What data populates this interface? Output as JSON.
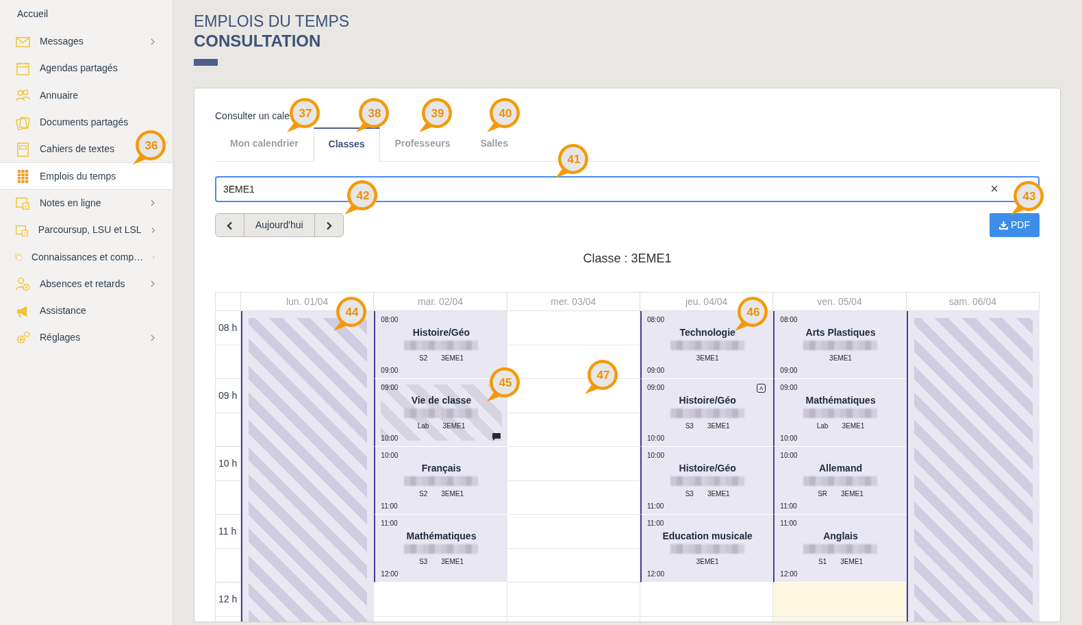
{
  "sidebar": {
    "home": "Accueil",
    "items": [
      {
        "label": "Messages",
        "submenu": true,
        "selected": false
      },
      {
        "label": "Agendas partagés",
        "submenu": false,
        "selected": false
      },
      {
        "label": "Annuaire",
        "submenu": false,
        "selected": false
      },
      {
        "label": "Documents partagés",
        "submenu": false,
        "selected": false
      },
      {
        "label": "Cahiers de textes",
        "submenu": false,
        "selected": false
      },
      {
        "label": "Emplois du temps",
        "submenu": false,
        "selected": true
      },
      {
        "label": "Notes en ligne",
        "submenu": true,
        "selected": false
      },
      {
        "label": "Parcoursup, LSU et LSL",
        "submenu": true,
        "selected": false
      },
      {
        "label": "Connaissances et comp…",
        "submenu": true,
        "selected": false
      },
      {
        "label": "Absences et retards",
        "submenu": true,
        "selected": false
      },
      {
        "label": "Assistance",
        "submenu": false,
        "selected": false
      },
      {
        "label": "Réglages",
        "submenu": true,
        "selected": false
      }
    ]
  },
  "page_title": {
    "line_1": "EMPLOIS DU TEMPS",
    "line_2": "CONSULTATION"
  },
  "consult_label": "Consulter un cale",
  "tabs": [
    {
      "label": "Mon calendrier",
      "selected": false
    },
    {
      "label": "Classes",
      "selected": true
    },
    {
      "label": "Professeurs",
      "selected": false
    },
    {
      "label": "Salles",
      "selected": false
    }
  ],
  "class_field": {
    "value": "3EME1",
    "clear": "×"
  },
  "today_button": "Aujourd'hui",
  "pdf_button": "PDF",
  "calendar_title": "Classe : 3EME1",
  "hours": [
    "08 h",
    "09 h",
    "10 h",
    "11 h",
    "12 h"
  ],
  "days": [
    {
      "label": "lun. 01/04",
      "closed": true,
      "today": false
    },
    {
      "label": "mar. 02/04",
      "closed": false,
      "today": false,
      "slots": [
        {
          "kind": "event",
          "start": "08:00",
          "end": "09:00",
          "subject": "Histoire/Géo",
          "room": "S2",
          "class": "3EME1",
          "hatched": false,
          "comment": false
        },
        {
          "kind": "event",
          "start": "09:00",
          "end": "10:00",
          "subject": "Vie de classe",
          "room": "Lab",
          "class": "3EME1",
          "hatched": true,
          "comment": true
        },
        {
          "kind": "event",
          "start": "10:00",
          "end": "11:00",
          "subject": "Français",
          "room": "S2",
          "class": "3EME1",
          "hatched": false,
          "comment": false
        },
        {
          "kind": "event",
          "start": "11:00",
          "end": "12:00",
          "subject": "Mathématiques",
          "room": "S3",
          "class": "3EME1",
          "hatched": false,
          "comment": false
        },
        {
          "kind": "empty"
        }
      ]
    },
    {
      "label": "mer. 03/04",
      "closed": false,
      "today": false,
      "slots": [
        {
          "kind": "empty"
        },
        {
          "kind": "empty"
        },
        {
          "kind": "empty"
        },
        {
          "kind": "empty"
        },
        {
          "kind": "empty"
        }
      ]
    },
    {
      "label": "jeu. 04/04",
      "closed": false,
      "today": false,
      "slots": [
        {
          "kind": "event",
          "start": "08:00",
          "end": "09:00",
          "subject": "Technologie",
          "class": "3EME1",
          "hatched": false,
          "comment": false
        },
        {
          "kind": "event",
          "start": "09:00",
          "end": "10:00",
          "subject": "Histoire/Géo",
          "room": "S3",
          "class": "3EME1",
          "hatched": false,
          "comment": false,
          "badge": "A"
        },
        {
          "kind": "event",
          "start": "10:00",
          "end": "11:00",
          "subject": "Histoire/Géo",
          "room": "S3",
          "class": "3EME1",
          "hatched": false,
          "comment": false
        },
        {
          "kind": "event",
          "start": "11:00",
          "end": "12:00",
          "subject": "Education musicale",
          "class": "3EME1",
          "hatched": false,
          "comment": false
        },
        {
          "kind": "empty"
        }
      ]
    },
    {
      "label": "ven. 05/04",
      "closed": false,
      "today": true,
      "slots": [
        {
          "kind": "event",
          "start": "08:00",
          "end": "09:00",
          "subject": "Arts Plastiques",
          "class": "3EME1",
          "hatched": false,
          "comment": false
        },
        {
          "kind": "event",
          "start": "09:00",
          "end": "10:00",
          "subject": "Mathématiques",
          "room": "Lab",
          "class": "3EME1",
          "hatched": false,
          "comment": false
        },
        {
          "kind": "event",
          "start": "10:00",
          "end": "11:00",
          "subject": "Allemand",
          "room": "SR",
          "class": "3EME1",
          "hatched": false,
          "comment": false
        },
        {
          "kind": "event",
          "start": "11:00",
          "end": "12:00",
          "subject": "Anglais",
          "room": "S1",
          "class": "3EME1",
          "hatched": false,
          "comment": false
        },
        {
          "kind": "empty"
        }
      ]
    },
    {
      "label": "sam. 06/04",
      "closed": true,
      "today": false
    }
  ],
  "annotations": [
    {
      "number": "36"
    },
    {
      "number": "37"
    },
    {
      "number": "38"
    },
    {
      "number": "39"
    },
    {
      "number": "40"
    },
    {
      "number": "41"
    },
    {
      "number": "42"
    },
    {
      "number": "43"
    },
    {
      "number": "44"
    },
    {
      "number": "45"
    },
    {
      "number": "46"
    },
    {
      "number": "47"
    }
  ]
}
